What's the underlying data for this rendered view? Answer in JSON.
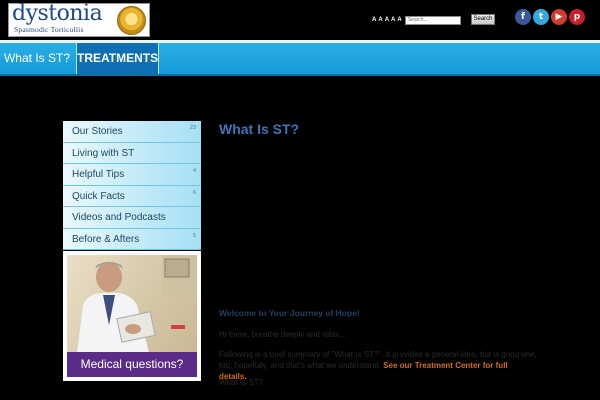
{
  "header": {
    "logo": {
      "word": "dystonia",
      "sub": "Spasmodic Torticollis"
    },
    "text_size_buttons": [
      "A",
      "A",
      "A",
      "A",
      "A"
    ],
    "search": {
      "placeholder": "Search...",
      "button_label": "Search"
    },
    "social_icons": [
      "facebook-icon",
      "twitter-icon",
      "youtube-icon",
      "pinterest-icon"
    ]
  },
  "nav": {
    "items": [
      {
        "label": "What Is ST?"
      },
      {
        "label": "TREATMENTS"
      }
    ]
  },
  "sidebar": {
    "items": [
      {
        "label": "Our Stories",
        "count": "23"
      },
      {
        "label": "Living with ST",
        "count": ""
      },
      {
        "label": "Helpful Tips",
        "count": "4"
      },
      {
        "label": "Quick Facts",
        "count": "6"
      },
      {
        "label": "Videos and Podcasts",
        "count": ""
      },
      {
        "label": "Before & Afters",
        "count": "5"
      }
    ],
    "promo_caption": "Medical questions?"
  },
  "main": {
    "title": "What Is ST?",
    "welcome_heading": "Welcome to Your Journey of Hope!",
    "intro": "Hi there, breathe deeply and relax...",
    "summary_text": "Following is a brief summary of \"What Is ST?\". It provides a general idea, but is good one, too, hopefully, and that's what we understand.",
    "summary_link": "See our Treatment Center for full details.",
    "subheading": "What Is ST?"
  },
  "colors": {
    "nav_bg": "#159bd9",
    "nav_active": "#0f6fb4",
    "title": "#3f74b6",
    "link": "#d06c1e",
    "promo_bar": "#5a2b87"
  }
}
